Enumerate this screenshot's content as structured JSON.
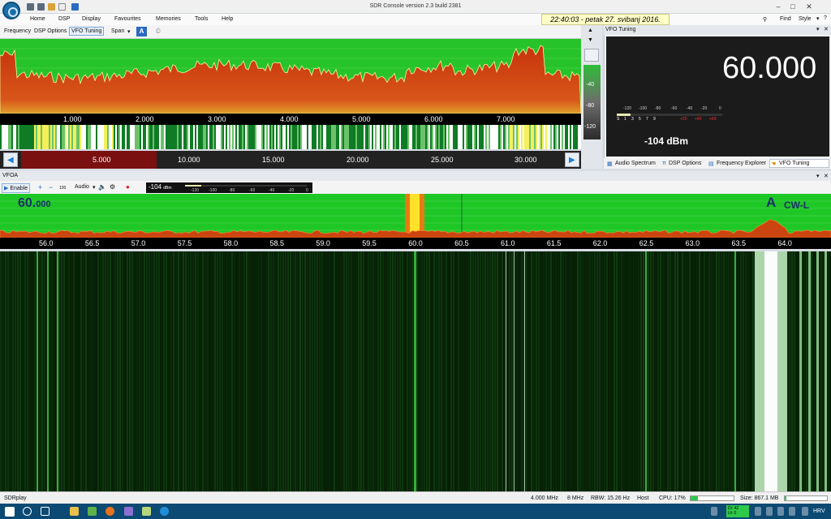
{
  "window": {
    "title": "SDR Console version 2.3 build 2381",
    "clock": "22:40:03  - petak 27. svibanj 2016.",
    "find_label": "Find",
    "style_label": "Style"
  },
  "menu": [
    {
      "label": "Home"
    },
    {
      "label": "DSP"
    },
    {
      "label": "Display"
    },
    {
      "label": "Favourites"
    },
    {
      "label": "Memories"
    },
    {
      "label": "Tools"
    },
    {
      "label": "Help"
    }
  ],
  "toolbar": {
    "frequency": "Frequency",
    "dsp_options": "DSP Options",
    "vfo_tuning": "VFO Tuning",
    "span": "Span",
    "a_button": "A"
  },
  "spectrum": {
    "ticks": [
      "1.000",
      "2.000",
      "3.000",
      "4.000",
      "5.000",
      "6.000",
      "7.000"
    ],
    "level_ticks": [
      "-40",
      "-80",
      "-120"
    ]
  },
  "overview": {
    "ticks": [
      "5.000",
      "10.000",
      "15.000",
      "20.000",
      "25.000",
      "30.000"
    ]
  },
  "vfo_panel": {
    "header": "VFO Tuning",
    "frequency": "60.000",
    "level": "-104 dBm",
    "dbm_scale": [
      "-120",
      "-100",
      "-80",
      "-60",
      "-40",
      "-20",
      "0"
    ],
    "s_scale": [
      "S",
      "1",
      "3",
      "5",
      "7",
      "9",
      "+20",
      "+40",
      "+60"
    ],
    "tabs": [
      {
        "label": "Audio Spectrum"
      },
      {
        "label": "DSP Options"
      },
      {
        "label": "Frequency Explorer"
      },
      {
        "label": "VFO Tuning"
      }
    ]
  },
  "vfoa": {
    "header": "VFOA",
    "enable": "Enable",
    "step": "100",
    "audio": "Audio",
    "smeter": "-104",
    "smeter_unit": "dBm",
    "smeter_scale": [
      "-120",
      "-100",
      "-80",
      "-60",
      "-40",
      "-20",
      "0"
    ],
    "frequency_big": "60.",
    "frequency_small": "000",
    "mode_letter": "A",
    "mode": "CW-L",
    "ticks": [
      "56.0",
      "56.5",
      "57.0",
      "57.5",
      "58.0",
      "58.5",
      "59.0",
      "59.5",
      "60.0",
      "60.5",
      "61.0",
      "61.5",
      "62.0",
      "62.5",
      "63.0",
      "63.5",
      "64.0"
    ]
  },
  "status": {
    "device": "SDRplay",
    "center": "4.000 MHz",
    "bandwidth": "8 MHz",
    "rbw": "RBW: 15.26 Hz",
    "host": "Host",
    "cpu": "CPU: 17%",
    "cpu_fraction": 0.17,
    "size": "Size: 867.1 MB"
  },
  "taskbar": {
    "badge_top": "Di: 42",
    "badge_bottom": "Ui: 0",
    "language": "HRV"
  },
  "colors": {
    "accent": "#1c7fd6",
    "spectrum_green": "#27c32a",
    "spectrum_red": "#d23a10",
    "taskbar": "#0c4a73"
  }
}
